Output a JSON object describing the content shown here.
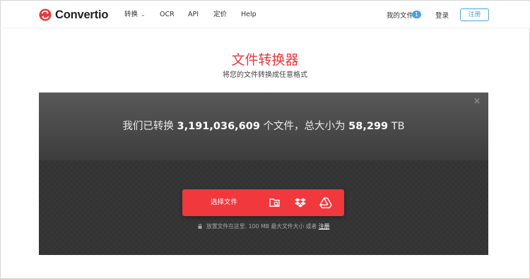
{
  "header": {
    "logo_text": "Convertio",
    "nav": [
      {
        "label": "转换",
        "has_dropdown": true
      },
      {
        "label": "OCR"
      },
      {
        "label": "API"
      },
      {
        "label": "定价"
      },
      {
        "label": "Help"
      }
    ],
    "my_files_label": "我的文件",
    "my_files_count": "1",
    "login_label": "登录",
    "register_label": "注册"
  },
  "hero": {
    "title": "文件转换器",
    "subtitle": "将您的文件转换成任意格式"
  },
  "converter": {
    "stats_prefix": "我们已转换",
    "files_count": "3,191,036,609",
    "stats_middle": "个文件，总大小为",
    "total_size": "58,299",
    "size_unit": "TB",
    "choose_label": "选择文件",
    "sources": [
      {
        "icon": "folder-search-icon"
      },
      {
        "icon": "dropbox-icon"
      },
      {
        "icon": "google-drive-icon"
      }
    ],
    "hint_text": "放置文件在这里. 100 MB 最大文件大小 或者",
    "hint_link": "注册",
    "close_glyph": "×"
  },
  "colors": {
    "brand_red": "#e8383d",
    "accent_blue": "#4aa3df",
    "panel_dark": "#333333"
  }
}
